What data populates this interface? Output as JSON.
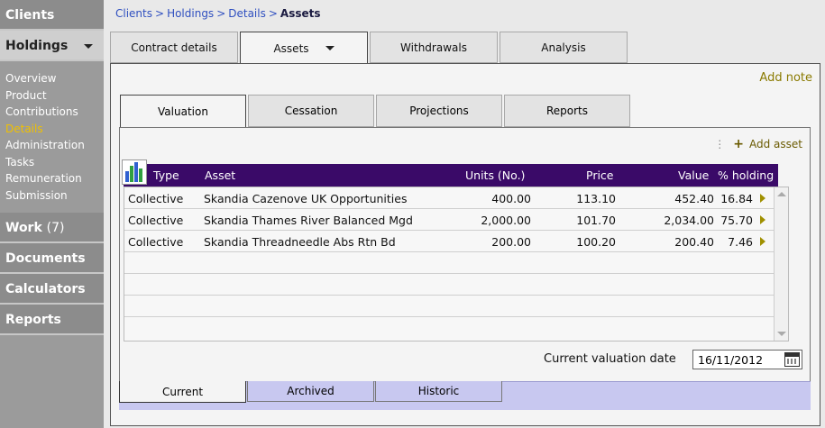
{
  "sidebar": {
    "sections": {
      "clients": "Clients",
      "holdings": "Holdings",
      "work": "Work",
      "work_count": "(7)",
      "documents": "Documents",
      "calculators": "Calculators",
      "reports": "Reports"
    },
    "holdings_items": [
      "Overview",
      "Product",
      "Contributions",
      "Details",
      "Administration",
      "Tasks",
      "Remuneration",
      "Submission"
    ]
  },
  "breadcrumb": {
    "items": [
      "Clients",
      "Holdings",
      "Details"
    ],
    "separator": ">",
    "current": "Assets"
  },
  "top_tabs": [
    "Contract details",
    "Assets",
    "Withdrawals",
    "Analysis"
  ],
  "add_note": "Add note",
  "sub_tabs": [
    "Valuation",
    "Cessation",
    "Projections",
    "Reports"
  ],
  "add_asset": {
    "dots": "⋮",
    "plus": "+",
    "label": "Add asset"
  },
  "grid": {
    "headers": {
      "type": "Type",
      "asset": "Asset",
      "units": "Units (No.)",
      "price": "Price",
      "value": "Value",
      "holding": "% holding"
    },
    "rows": [
      {
        "type": "Collective",
        "asset": "Skandia Cazenove UK Opportunities",
        "units": "400.00",
        "price": "113.10",
        "value": "452.40",
        "holding": "16.84"
      },
      {
        "type": "Collective",
        "asset": "Skandia Thames River Balanced Mgd",
        "units": "2,000.00",
        "price": "101.70",
        "value": "2,034.00",
        "holding": "75.70"
      },
      {
        "type": "Collective",
        "asset": "Skandia Threadneedle Abs Rtn Bd",
        "units": "200.00",
        "price": "100.20",
        "value": "200.40",
        "holding": "7.46"
      }
    ]
  },
  "valuation_date": {
    "label": "Current valuation date",
    "value": "16/11/2012"
  },
  "bottom_tabs": [
    "Current",
    "Archived",
    "Historic"
  ],
  "colors": {
    "grid_header": "#3a0a68",
    "link_gold": "#8a7a00",
    "bottom_strip": "#c8c8f0",
    "active_nav": "#f0c000"
  }
}
